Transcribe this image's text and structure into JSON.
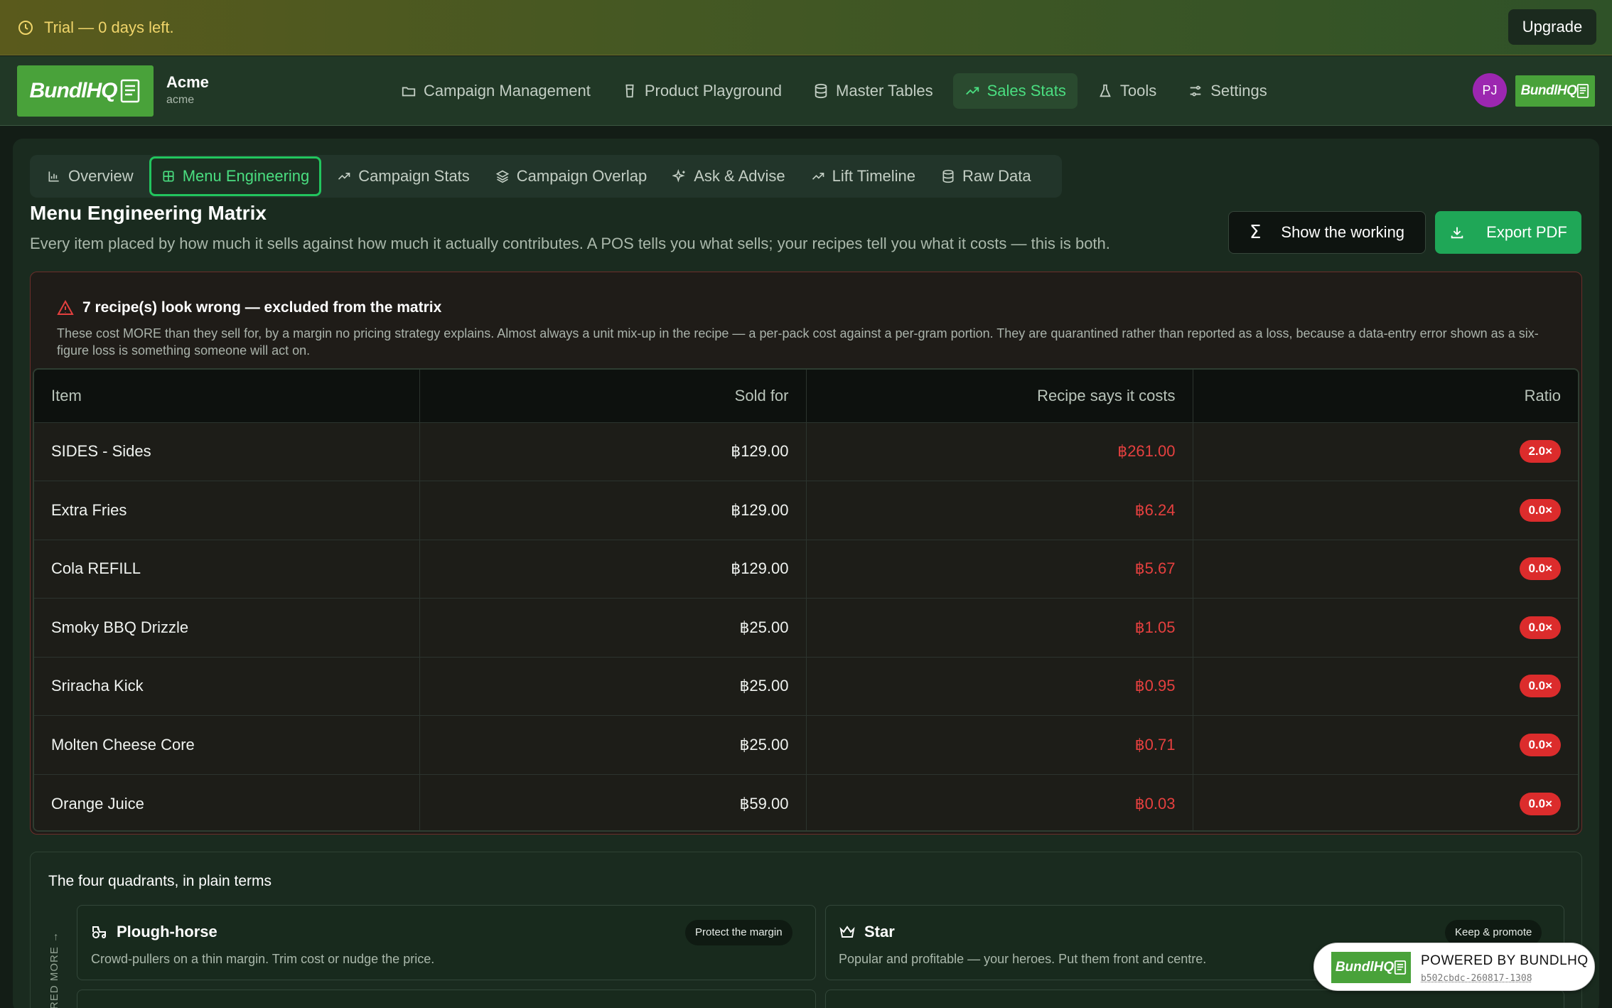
{
  "trial": {
    "text": "Trial — 0 days left.",
    "upgrade_label": "Upgrade"
  },
  "brand": {
    "logo_text": "BundlHQ",
    "org_name": "Acme",
    "org_slug": "acme",
    "avatar_initials": "PJ"
  },
  "nav": {
    "items": [
      {
        "label": "Campaign Management",
        "icon": "folder-icon",
        "active": false
      },
      {
        "label": "Product Playground",
        "icon": "cup-icon",
        "active": false
      },
      {
        "label": "Master Tables",
        "icon": "database-icon",
        "active": false
      },
      {
        "label": "Sales Stats",
        "icon": "trending-up-icon",
        "active": true
      },
      {
        "label": "Tools",
        "icon": "flask-icon",
        "active": false
      },
      {
        "label": "Settings",
        "icon": "sliders-icon",
        "active": false
      }
    ]
  },
  "subtabs": [
    {
      "label": "Overview",
      "icon": "bar-chart-icon",
      "active": false
    },
    {
      "label": "Menu Engineering",
      "icon": "grid-icon",
      "active": true
    },
    {
      "label": "Campaign Stats",
      "icon": "trending-up-icon",
      "active": false
    },
    {
      "label": "Campaign Overlap",
      "icon": "layers-icon",
      "active": false
    },
    {
      "label": "Ask & Advise",
      "icon": "sparkles-icon",
      "active": false
    },
    {
      "label": "Lift Timeline",
      "icon": "trending-up-icon",
      "active": false
    },
    {
      "label": "Raw Data",
      "icon": "database-icon",
      "active": false
    }
  ],
  "page": {
    "title": "Menu Engineering Matrix",
    "subtitle": "Every item placed by how much it sells against how much it actually contributes. A POS tells you what sells; your recipes tell you what it costs — this is both.",
    "show_working_label": "Show the working",
    "export_label": "Export PDF"
  },
  "warning": {
    "title": "7 recipe(s) look wrong — excluded from the matrix",
    "description": "These cost MORE than they sell for, by a margin no pricing strategy explains. Almost always a unit mix-up in the recipe — a per-pack cost against a per-gram portion. They are quarantined rather than reported as a loss, because a data-entry error shown as a six-figure loss is something someone will act on.",
    "columns": [
      "Item",
      "Sold for",
      "Recipe says it costs",
      "Ratio"
    ],
    "rows": [
      {
        "item": "SIDES - Sides",
        "sold": "฿129.00",
        "cost": "฿261.00",
        "ratio": "2.0×"
      },
      {
        "item": "Extra Fries",
        "sold": "฿129.00",
        "cost": "฿6.24",
        "ratio": "0.0×"
      },
      {
        "item": "Cola REFILL",
        "sold": "฿129.00",
        "cost": "฿5.67",
        "ratio": "0.0×"
      },
      {
        "item": "Smoky BBQ Drizzle",
        "sold": "฿25.00",
        "cost": "฿1.05",
        "ratio": "0.0×"
      },
      {
        "item": "Sriracha Kick",
        "sold": "฿25.00",
        "cost": "฿0.95",
        "ratio": "0.0×"
      },
      {
        "item": "Molten Cheese Core",
        "sold": "฿25.00",
        "cost": "฿0.71",
        "ratio": "0.0×"
      },
      {
        "item": "Orange Juice",
        "sold": "฿59.00",
        "cost": "฿0.03",
        "ratio": "0.0×"
      }
    ]
  },
  "quadrants": {
    "title": "The four quadrants, in plain terms",
    "axis_label": "RED MORE →",
    "items": [
      {
        "name": "Plough-horse",
        "icon": "tractor-icon",
        "desc": "Crowd-pullers on a thin margin. Trim cost or nudge the price.",
        "tag": "Protect the margin"
      },
      {
        "name": "Star",
        "icon": "crown-icon",
        "desc": "Popular and profitable — your heroes. Put them front and centre.",
        "tag": "Keep & promote"
      }
    ]
  },
  "powered": {
    "text": "POWERED BY BUNDLHQ",
    "build": "b502cbdc-260817-1308"
  },
  "colors": {
    "accent": "#22c55e",
    "danger": "#dc2c2c",
    "trial": "#f0d56a",
    "logo_bg": "#49a23a"
  }
}
